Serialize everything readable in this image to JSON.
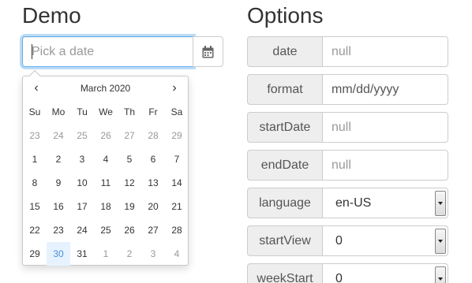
{
  "demo": {
    "title": "Demo",
    "date_input": {
      "placeholder": "Pick a date",
      "value": ""
    },
    "addon_icon": "calendar-icon"
  },
  "calendar": {
    "prev_label": "‹",
    "next_label": "›",
    "month_label": "March 2020",
    "weekdays": [
      "Su",
      "Mo",
      "Tu",
      "We",
      "Th",
      "Fr",
      "Sa"
    ],
    "weeks": [
      [
        {
          "d": "23",
          "o": true
        },
        {
          "d": "24",
          "o": true
        },
        {
          "d": "25",
          "o": true
        },
        {
          "d": "26",
          "o": true
        },
        {
          "d": "27",
          "o": true
        },
        {
          "d": "28",
          "o": true
        },
        {
          "d": "29",
          "o": true
        }
      ],
      [
        {
          "d": "1"
        },
        {
          "d": "2"
        },
        {
          "d": "3"
        },
        {
          "d": "4"
        },
        {
          "d": "5"
        },
        {
          "d": "6"
        },
        {
          "d": "7"
        }
      ],
      [
        {
          "d": "8"
        },
        {
          "d": "9"
        },
        {
          "d": "10"
        },
        {
          "d": "11"
        },
        {
          "d": "12"
        },
        {
          "d": "13"
        },
        {
          "d": "14"
        }
      ],
      [
        {
          "d": "15"
        },
        {
          "d": "16"
        },
        {
          "d": "17"
        },
        {
          "d": "18"
        },
        {
          "d": "19"
        },
        {
          "d": "20"
        },
        {
          "d": "21"
        }
      ],
      [
        {
          "d": "22"
        },
        {
          "d": "23"
        },
        {
          "d": "24"
        },
        {
          "d": "25"
        },
        {
          "d": "26"
        },
        {
          "d": "27"
        },
        {
          "d": "28"
        }
      ],
      [
        {
          "d": "29"
        },
        {
          "d": "30",
          "today": true
        },
        {
          "d": "31"
        },
        {
          "d": "1",
          "o": true
        },
        {
          "d": "2",
          "o": true
        },
        {
          "d": "3",
          "o": true
        },
        {
          "d": "4",
          "o": true
        }
      ]
    ]
  },
  "options": {
    "title": "Options",
    "rows": [
      {
        "label": "date",
        "type": "input",
        "placeholder": "null",
        "value": ""
      },
      {
        "label": "format",
        "type": "input",
        "placeholder": "",
        "value": "mm/dd/yyyy"
      },
      {
        "label": "startDate",
        "type": "input",
        "placeholder": "null",
        "value": ""
      },
      {
        "label": "endDate",
        "type": "input",
        "placeholder": "null",
        "value": ""
      },
      {
        "label": "language",
        "type": "select",
        "value": "en-US"
      },
      {
        "label": "startView",
        "type": "select",
        "value": "0"
      },
      {
        "label": "weekStart",
        "type": "select",
        "value": "0"
      }
    ]
  },
  "colors": {
    "focus_border": "#66afe9",
    "today_bg": "#e6f3ff",
    "today_text": "#4a90d9",
    "label_bg": "#eeeeee",
    "muted_text": "#999999"
  }
}
